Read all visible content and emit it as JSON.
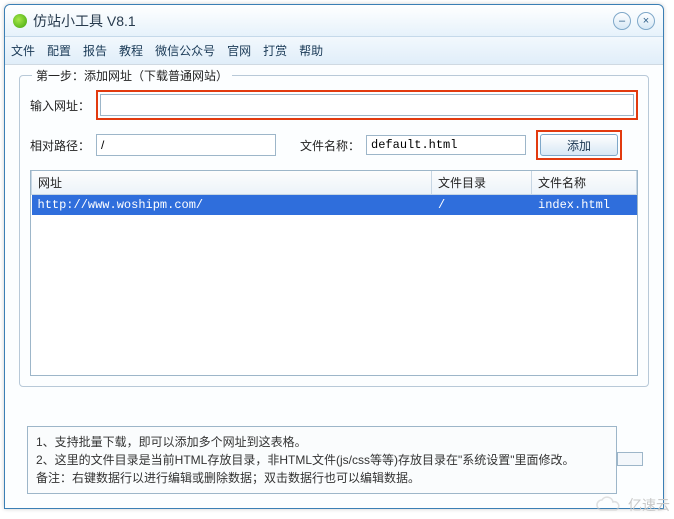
{
  "window": {
    "title": "仿站小工具 V8.1"
  },
  "menu": {
    "file": "文件",
    "config": "配置",
    "report": "报告",
    "tutorial": "教程",
    "wechat": "微信公众号",
    "official": "官网",
    "reward": "打赏",
    "help": "帮助"
  },
  "step1": {
    "group_title": "第一步：添加网址（下载普通网站）",
    "url_label": "输入网址：",
    "url_value": "",
    "path_label": "相对路径：",
    "path_value": "/",
    "name_label": "文件名称：",
    "name_value": "default.html",
    "add_button": "添加"
  },
  "table": {
    "headers": {
      "url": "网址",
      "dir": "文件目录",
      "name": "文件名称"
    },
    "rows": [
      {
        "url": "http://www.woshipm.com/",
        "dir": "/",
        "name": "index.html"
      }
    ]
  },
  "hints": {
    "line1": "1、支持批量下载，即可以添加多个网址到这表格。",
    "line2": "2、这里的文件目录是当前HTML存放目录，非HTML文件(js/css等等)存放目录在\"系统设置\"里面修改。",
    "line3": "备注：右键数据行以进行编辑或删除数据；双击数据行也可以编辑数据。"
  },
  "watermark": "亿速云"
}
